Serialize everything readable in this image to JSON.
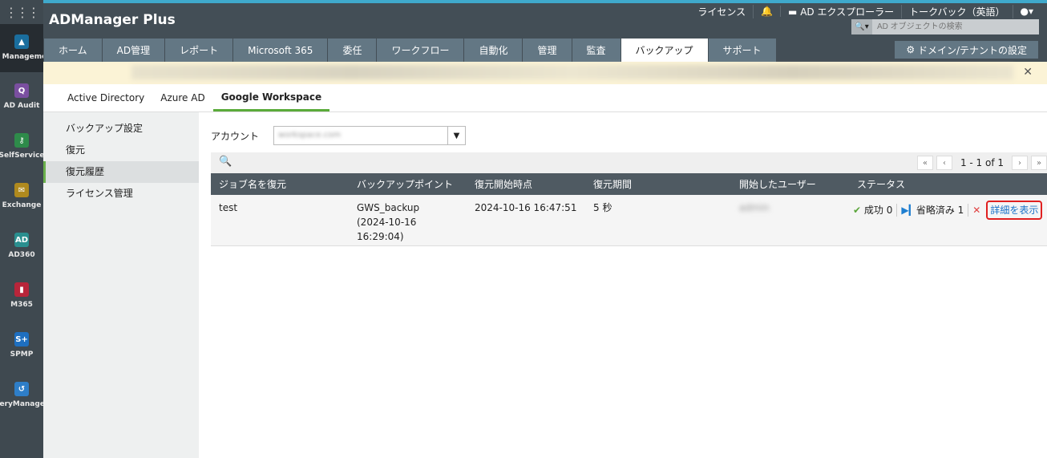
{
  "rail": {
    "items": [
      {
        "label": "AD Management",
        "color": "#1a6e9e",
        "glyph": "▲"
      },
      {
        "label": "AD Audit",
        "color": "#7a4fa0",
        "glyph": "Q"
      },
      {
        "label": "SelfService",
        "color": "#2e8b4a",
        "glyph": "⚷"
      },
      {
        "label": "Exchange",
        "color": "#b08a1e",
        "glyph": "✉"
      },
      {
        "label": "AD360",
        "color": "#2a8f8f",
        "glyph": "AD"
      },
      {
        "label": "M365",
        "color": "#b8253a",
        "glyph": "▮"
      },
      {
        "label": "SPMP",
        "color": "#1e6fc0",
        "glyph": "S+"
      },
      {
        "label": "RecoveryManager Plus",
        "color": "#2e7ec8",
        "glyph": "↺"
      }
    ]
  },
  "header": {
    "logo": "ADManager Plus",
    "links": [
      "ライセンス",
      "AD エクスプローラー",
      "トークバック（英語）"
    ],
    "search_placeholder": "AD オブジェクトの検索",
    "domain_button": "ドメイン/テナントの設定"
  },
  "tabs": [
    "ホーム",
    "AD管理",
    "レポート",
    "Microsoft 365",
    "委任",
    "ワークフロー",
    "自動化",
    "管理",
    "監査",
    "バックアップ",
    "サポート"
  ],
  "subtabs": [
    "Active Directory",
    "Azure AD",
    "Google Workspace"
  ],
  "menu": [
    "バックアップ設定",
    "復元",
    "復元履歴",
    "ライセンス管理"
  ],
  "account_label": "アカウント",
  "pager": "1 - 1 of 1",
  "columns": [
    "ジョブ名を復元",
    "バックアップポイント",
    "復元開始時点",
    "復元期間",
    "開始したユーザー",
    "ステータス"
  ],
  "row": {
    "job": "test",
    "point": "GWS_backup",
    "point_date": "(2024-10-16",
    "point_time": "16:29:04)",
    "start": "2024-10-16 16:47:51",
    "duration": "5 秒",
    "user": "admin",
    "success": "成功 0",
    "skipped": "省略済み 1",
    "detail": "詳細を表示"
  }
}
